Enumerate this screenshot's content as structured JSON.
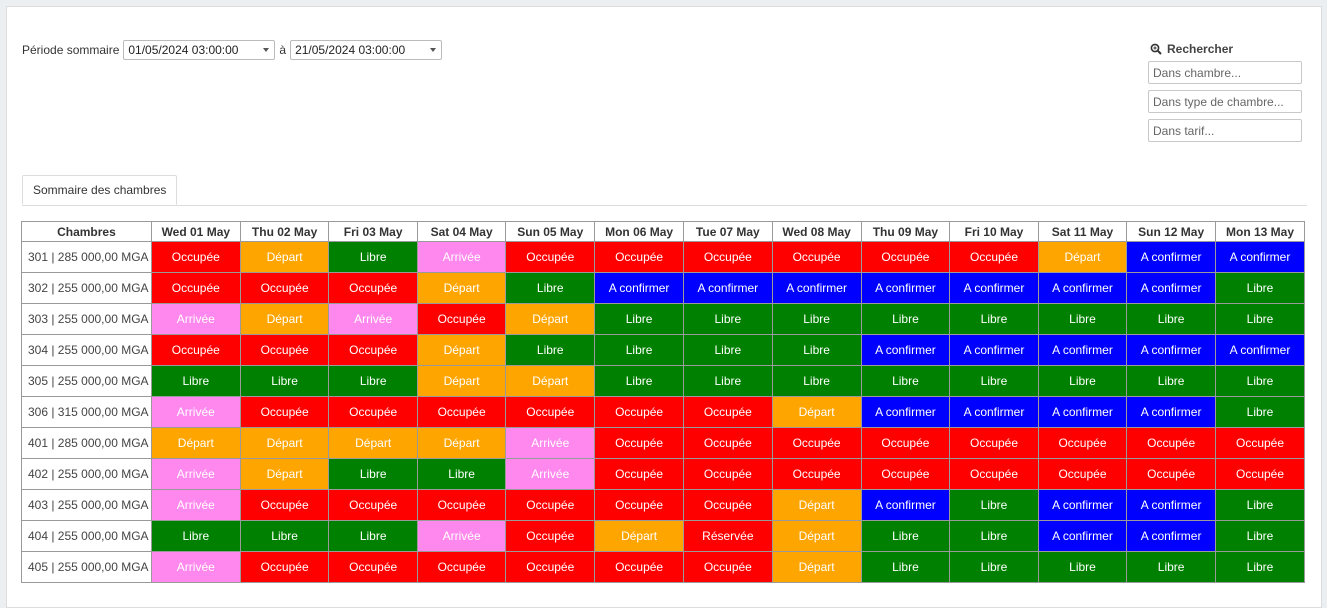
{
  "period": {
    "label": "Période sommaire",
    "from": "01/05/2024 03:00:00",
    "sep": "à",
    "to": "21/05/2024 03:00:00"
  },
  "search": {
    "title": "Rechercher",
    "room_placeholder": "Dans chambre...",
    "type_placeholder": "Dans type de chambre...",
    "rate_placeholder": "Dans tarif..."
  },
  "tabs": [
    "Sommaire des chambres"
  ],
  "status_colors": {
    "Occupée": "#ff0000",
    "Départ": "#ffa500",
    "Libre": "#008000",
    "Arrivée": "#ff88ee",
    "A confirmer": "#0000ff",
    "Réservée": "#ff0000"
  },
  "grid": {
    "room_header": "Chambres",
    "days": [
      "Wed 01 May",
      "Thu 02 May",
      "Fri 03 May",
      "Sat 04 May",
      "Sun 05 May",
      "Mon 06 May",
      "Tue 07 May",
      "Wed 08 May",
      "Thu 09 May",
      "Fri 10 May",
      "Sat 11 May",
      "Sun 12 May",
      "Mon 13 May"
    ],
    "rows": [
      {
        "room": "301 | 285 000,00 MGA",
        "cells": [
          "Occupée",
          "Départ",
          "Libre",
          "Arrivée",
          "Occupée",
          "Occupée",
          "Occupée",
          "Occupée",
          "Occupée",
          "Occupée",
          "Départ",
          "A confirmer",
          "A confirmer"
        ]
      },
      {
        "room": "302 | 255 000,00 MGA",
        "cells": [
          "Occupée",
          "Occupée",
          "Occupée",
          "Départ",
          "Libre",
          "A confirmer",
          "A confirmer",
          "A confirmer",
          "A confirmer",
          "A confirmer",
          "A confirmer",
          "A confirmer",
          "Libre"
        ]
      },
      {
        "room": "303 | 255 000,00 MGA",
        "cells": [
          "Arrivée",
          "Départ",
          "Arrivée",
          "Occupée",
          "Départ",
          "Libre",
          "Libre",
          "Libre",
          "Libre",
          "Libre",
          "Libre",
          "Libre",
          "Libre"
        ]
      },
      {
        "room": "304 | 255 000,00 MGA",
        "cells": [
          "Occupée",
          "Occupée",
          "Occupée",
          "Départ",
          "Libre",
          "Libre",
          "Libre",
          "Libre",
          "A confirmer",
          "A confirmer",
          "A confirmer",
          "A confirmer",
          "A confirmer"
        ]
      },
      {
        "room": "305 | 255 000,00 MGA",
        "cells": [
          "Libre",
          "Libre",
          "Libre",
          "Départ",
          "Départ",
          "Libre",
          "Libre",
          "Libre",
          "Libre",
          "Libre",
          "Libre",
          "Libre",
          "Libre"
        ]
      },
      {
        "room": "306 | 315 000,00 MGA",
        "cells": [
          "Arrivée",
          "Occupée",
          "Occupée",
          "Occupée",
          "Occupée",
          "Occupée",
          "Occupée",
          "Départ",
          "A confirmer",
          "A confirmer",
          "A confirmer",
          "A confirmer",
          "Libre"
        ]
      },
      {
        "room": "401 | 285 000,00 MGA",
        "cells": [
          "Départ",
          "Départ",
          "Départ",
          "Départ",
          "Arrivée",
          "Occupée",
          "Occupée",
          "Occupée",
          "Occupée",
          "Occupée",
          "Occupée",
          "Occupée",
          "Occupée"
        ]
      },
      {
        "room": "402 | 255 000,00 MGA",
        "cells": [
          "Arrivée",
          "Départ",
          "Libre",
          "Libre",
          "Arrivée",
          "Occupée",
          "Occupée",
          "Occupée",
          "Occupée",
          "Occupée",
          "Occupée",
          "Occupée",
          "Occupée"
        ]
      },
      {
        "room": "403 | 255 000,00 MGA",
        "cells": [
          "Arrivée",
          "Occupée",
          "Occupée",
          "Occupée",
          "Occupée",
          "Occupée",
          "Occupée",
          "Départ",
          "A confirmer",
          "Libre",
          "A confirmer",
          "A confirmer",
          "Libre"
        ]
      },
      {
        "room": "404 | 255 000,00 MGA",
        "cells": [
          "Libre",
          "Libre",
          "Libre",
          "Arrivée",
          "Occupée",
          "Départ",
          "Réservée",
          "Départ",
          "Libre",
          "Libre",
          "A confirmer",
          "A confirmer",
          "Libre"
        ]
      },
      {
        "room": "405 | 255 000,00 MGA",
        "cells": [
          "Arrivée",
          "Occupée",
          "Occupée",
          "Occupée",
          "Occupée",
          "Occupée",
          "Occupée",
          "Départ",
          "Libre",
          "Libre",
          "Libre",
          "Libre",
          "Libre"
        ]
      }
    ]
  }
}
